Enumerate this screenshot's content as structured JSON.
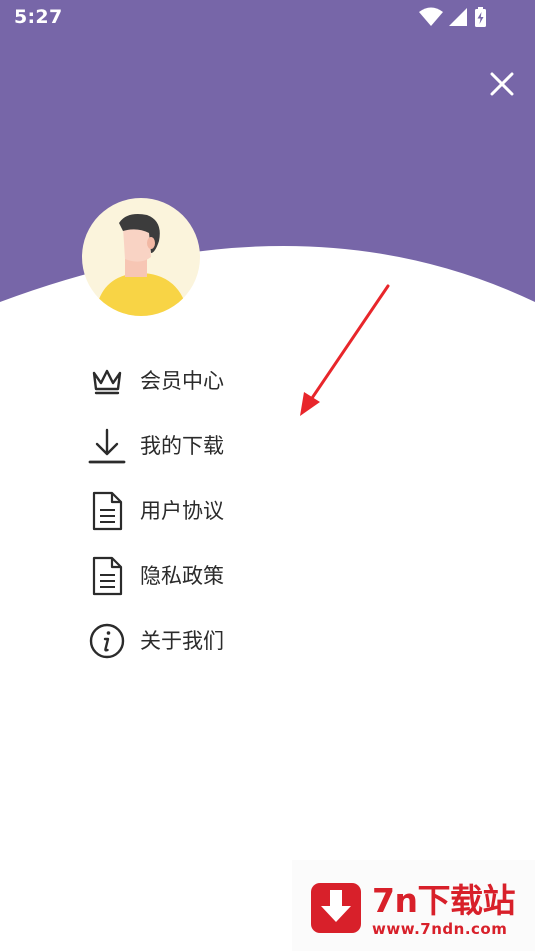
{
  "status_bar": {
    "time": "5:27",
    "icons": [
      "wifi-icon",
      "signal-icon",
      "battery-charging-icon"
    ]
  },
  "colors": {
    "header": "#7766a8",
    "text": "#2b2b2b",
    "arrow": "#e8262b",
    "avatar_bg": "#fbf4dc",
    "avatar_shirt": "#f8d445",
    "watermark_red": "#d8202a"
  },
  "header": {
    "close_icon": "close-icon"
  },
  "menu": {
    "items": [
      {
        "label": "会员中心",
        "icon": "crown-icon"
      },
      {
        "label": "我的下载",
        "icon": "download-icon"
      },
      {
        "label": "用户协议",
        "icon": "document-icon"
      },
      {
        "label": "隐私政策",
        "icon": "document-icon"
      },
      {
        "label": "关于我们",
        "icon": "info-icon"
      }
    ]
  },
  "watermark": {
    "title": "7n下载站",
    "url": "www.7ndn.com"
  }
}
